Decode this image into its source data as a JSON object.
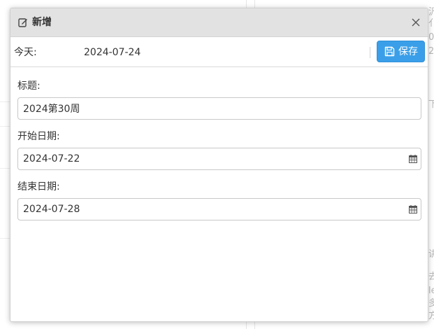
{
  "modal": {
    "title": "新增",
    "title_icon": "edit-icon",
    "close_icon": "close-icon"
  },
  "toolbar": {
    "today_label": "今天:",
    "today_value": "2024-07-24",
    "save_label": "保存",
    "save_icon": "floppy-disk-icon",
    "save_color": "#3a9fe8"
  },
  "form": {
    "title_label": "标题:",
    "title_value": "2024第30周",
    "start_label": "开始日期:",
    "start_value": "2024-07-22",
    "end_label": "结束日期:",
    "end_value": "2024-07-28",
    "calendar_icon": "calendar-icon"
  },
  "background": {
    "fragments": [
      "汎",
      "亻",
      "0",
      "2",
      "下",
      "讲",
      "去",
      "le",
      "多",
      "方"
    ]
  }
}
